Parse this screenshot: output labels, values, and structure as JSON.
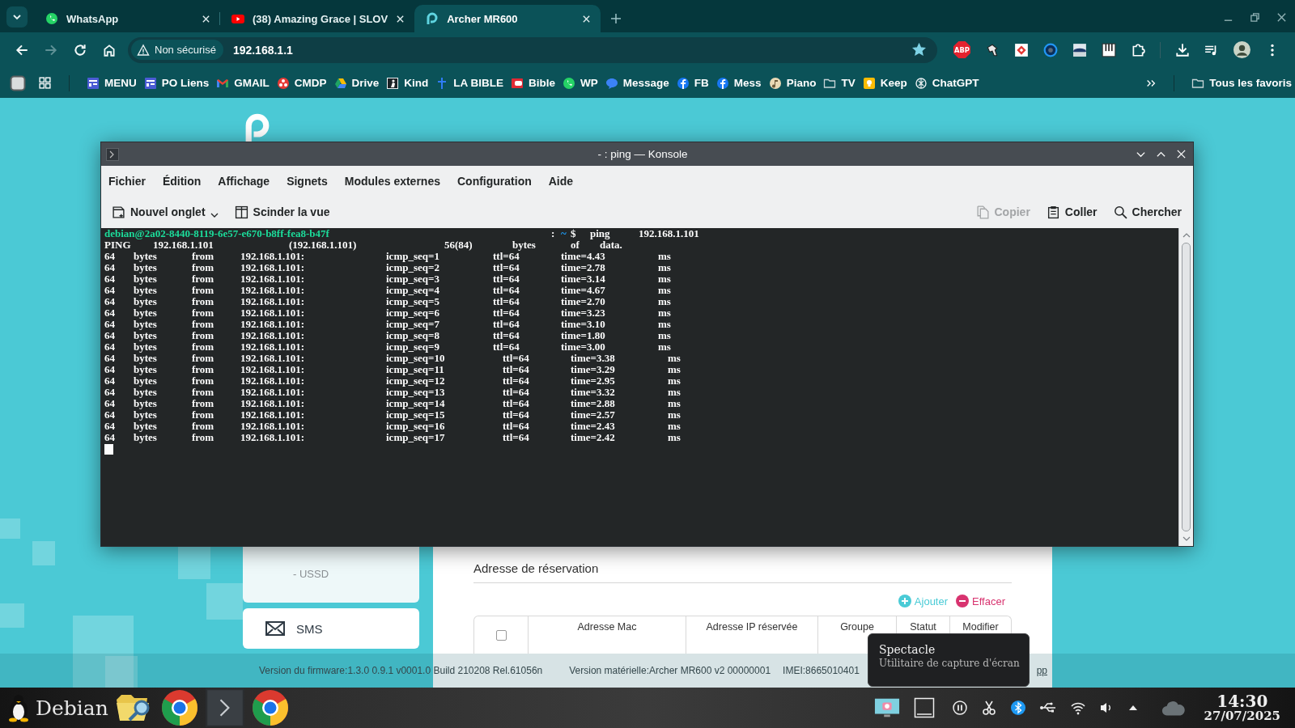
{
  "browser": {
    "tabs": [
      {
        "title": "WhatsApp",
        "selected": false
      },
      {
        "title": "(38) Amazing Grace | SLOV",
        "selected": false
      },
      {
        "title": "Archer MR600",
        "selected": true
      }
    ],
    "nav_buttons": [
      {
        "disabled": false
      },
      {
        "disabled": true
      },
      {
        "disabled": false
      },
      {
        "disabled": false
      }
    ],
    "address_bar": {
      "security_chip": "Non sécurisé",
      "url": "192.168.1.1",
      "bookmarked": true
    },
    "extension_badge": "ABP",
    "bookmarks": [
      {
        "label": "MENU"
      },
      {
        "label": "PO Liens"
      },
      {
        "label": "GMAIL"
      },
      {
        "label": "CMDP"
      },
      {
        "label": "Drive"
      },
      {
        "label": "Kind"
      },
      {
        "label": "LA BIBLE"
      },
      {
        "label": "Bible"
      },
      {
        "label": "WP"
      },
      {
        "label": "Message"
      },
      {
        "label": "FB"
      },
      {
        "label": "Mess"
      },
      {
        "label": "Piano"
      },
      {
        "label": "TV"
      },
      {
        "label": "Keep"
      },
      {
        "label": "ChatGPT"
      }
    ],
    "all_bookmarks": "Tous les favoris"
  },
  "router_page": {
    "sidebar": [
      {
        "label": "- USSD",
        "kind": "subitem"
      },
      {
        "label": "SMS",
        "kind": "item"
      }
    ],
    "section_title": "Adresse de réservation",
    "actions": [
      {
        "label": "Ajouter",
        "kind": "add"
      },
      {
        "label": "Effacer",
        "kind": "delete"
      }
    ],
    "table": {
      "select_all_checked": false,
      "columns": [
        "Adresse Mac",
        "Adresse IP réservée",
        "Groupe",
        "Statut",
        "Modifier"
      ]
    },
    "footer": [
      "Version du firmware:1.3.0 0.9.1 v0001.0 Build 210208 Rel.61056n",
      "Version matérielle:Archer MR600 v2 00000001",
      "IMEI:8665010401"
    ],
    "footer_link": "pp"
  },
  "konsole": {
    "title": "- : ping — Konsole",
    "menu": [
      "Fichier",
      "Édition",
      "Affichage",
      "Signets",
      "Modules externes",
      "Configuration",
      "Aide"
    ],
    "toolbar_left": [
      {
        "label": "Nouvel onglet",
        "kind": "new-tab"
      },
      {
        "label": "Scinder la vue",
        "kind": "split"
      }
    ],
    "toolbar_right": [
      {
        "label": "Copier",
        "kind": "copy",
        "disabled": true
      },
      {
        "label": "Coller",
        "kind": "paste",
        "disabled": false
      },
      {
        "label": "Chercher",
        "kind": "search",
        "disabled": false
      }
    ],
    "lines": [
      {
        "kind": "prompt",
        "user": "debian@2a02-8440-8119-6e57-e670-b8ff-fea8-b47f",
        "separator": ":",
        "path": "~",
        "command": "$ ping 192.168.1.101"
      },
      {
        "kind": "output",
        "text": "PING 192.168.1.101 (192.168.1.101) 56(84) bytes of data."
      },
      {
        "kind": "output",
        "text": "64 bytes from 192.168.1.101: icmp_seq=1 ttl=64 time=4.43 ms"
      },
      {
        "kind": "output",
        "text": "64 bytes from 192.168.1.101: icmp_seq=2 ttl=64 time=2.78 ms"
      },
      {
        "kind": "output",
        "text": "64 bytes from 192.168.1.101: icmp_seq=3 ttl=64 time=3.14 ms"
      },
      {
        "kind": "output",
        "text": "64 bytes from 192.168.1.101: icmp_seq=4 ttl=64 time=4.67 ms"
      },
      {
        "kind": "output",
        "text": "64 bytes from 192.168.1.101: icmp_seq=5 ttl=64 time=2.70 ms"
      },
      {
        "kind": "output",
        "text": "64 bytes from 192.168.1.101: icmp_seq=6 ttl=64 time=3.23 ms"
      },
      {
        "kind": "output",
        "text": "64 bytes from 192.168.1.101: icmp_seq=7 ttl=64 time=3.10 ms"
      },
      {
        "kind": "output",
        "text": "64 bytes from 192.168.1.101: icmp_seq=8 ttl=64 time=1.80 ms"
      },
      {
        "kind": "output",
        "text": "64 bytes from 192.168.1.101: icmp_seq=9 ttl=64 time=3.00 ms"
      },
      {
        "kind": "output",
        "text": "64 bytes from 192.168.1.101: icmp_seq=10 ttl=64 time=3.38 ms"
      },
      {
        "kind": "output",
        "text": "64 bytes from 192.168.1.101: icmp_seq=11 ttl=64 time=3.29 ms"
      },
      {
        "kind": "output",
        "text": "64 bytes from 192.168.1.101: icmp_seq=12 ttl=64 time=2.95 ms"
      },
      {
        "kind": "output",
        "text": "64 bytes from 192.168.1.101: icmp_seq=13 ttl=64 time=3.32 ms"
      },
      {
        "kind": "output",
        "text": "64 bytes from 192.168.1.101: icmp_seq=14 ttl=64 time=2.88 ms"
      },
      {
        "kind": "output",
        "text": "64 bytes from 192.168.1.101: icmp_seq=15 ttl=64 time=2.57 ms"
      },
      {
        "kind": "output",
        "text": "64 bytes from 192.168.1.101: icmp_seq=16 ttl=64 time=2.43 ms"
      },
      {
        "kind": "output",
        "text": "64 bytes from 192.168.1.101: icmp_seq=17 ttl=64 time=2.42 ms"
      },
      {
        "kind": "cursor"
      }
    ]
  },
  "tooltip": {
    "title": "Spectacle",
    "subtitle": "Utilitaire de capture d'écran"
  },
  "taskbar": {
    "start_label": "Debian",
    "time": "14:30",
    "date": "27/07/2025"
  }
}
